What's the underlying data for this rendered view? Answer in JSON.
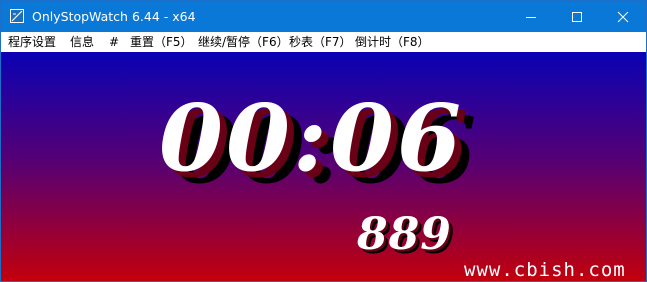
{
  "window": {
    "title": "OnlyStopWatch 6.44 - x64"
  },
  "menu": {
    "items": [
      "程序设置",
      "信息",
      "#",
      "重置（F5）",
      "继续/暂停（F6）",
      "秒表（F7）",
      "倒计时（F8）"
    ]
  },
  "display": {
    "time": "00:06",
    "milliseconds": "889",
    "watermark": "www.cbish.com",
    "colors": {
      "gradient_top": "#0a02b4",
      "gradient_bottom": "#c2000c",
      "digits": "#ffffff",
      "shadow": "#000000"
    }
  }
}
